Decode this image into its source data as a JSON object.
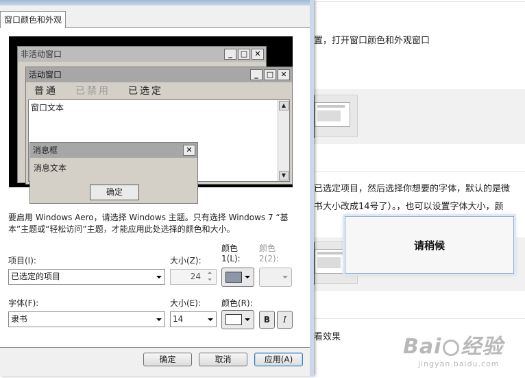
{
  "background_page": {
    "line1": "置，打开窗口颜色和外观窗口",
    "line2": "已选定项目，然后选择你想要的字体，默认的是微",
    "line3": "书大小改成14号了）。，也可以设置字体大小，颜",
    "line4": "看效果",
    "wait_box": "请稍候",
    "watermark_main": "Bai",
    "watermark_cn": "经验",
    "watermark_sub": "jingyan.baidu.com"
  },
  "dialog": {
    "tab": "窗口颜色和外观",
    "preview": {
      "inactive_title": "非活动窗口",
      "active_title": "活动窗口",
      "menu_normal": "普通",
      "menu_disabled": "已禁用",
      "menu_selected": "已选定",
      "window_text": "窗口文本",
      "msgbox_title": "消息框",
      "msgbox_text": "消息文本",
      "msgbox_ok": "确定",
      "minimize_glyph": "_",
      "maximize_glyph": "□",
      "close_glyph": "✕",
      "scroll_up_glyph": "▲",
      "scroll_down_glyph": "▼"
    },
    "description": "要启用 Windows Aero，请选择 Windows 主题。只有选择 Windows 7 “基本”主题或“轻松访问”主题，才能应用此处选择的颜色和大小。",
    "item_label": "项目(I):",
    "item_value": "已选定的项目",
    "item_size_label": "大小(Z):",
    "item_size_value": "24",
    "color1_label_top": "颜色",
    "color1_label": "1(L):",
    "color2_label_top": "颜色",
    "color2_label": "2(2):",
    "font_label": "字体(F):",
    "font_value": "隶书",
    "font_size_label": "大小(E):",
    "font_size_value": "14",
    "font_color_label": "颜色(R):",
    "bold_label": "B",
    "italic_label": "I",
    "ok_button": "确定",
    "cancel_button": "取消",
    "apply_button": "应用(A)"
  },
  "colors": {
    "color1_swatch": "#8d97a9",
    "font_color_swatch": "#ffffff"
  },
  "icons": [
    "minimize-icon",
    "maximize-icon",
    "close-icon",
    "scroll-up-icon",
    "scroll-down-icon",
    "dropdown-arrow-icon",
    "spin-up-icon",
    "spin-down-icon"
  ]
}
